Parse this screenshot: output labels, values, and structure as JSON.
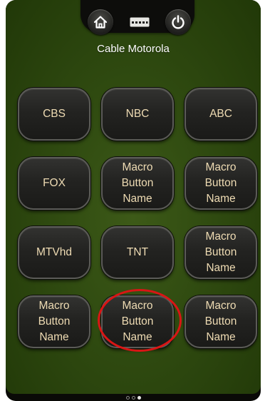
{
  "header": {
    "home_icon": "home-icon",
    "keyboard_icon": "keyboard-icon",
    "power_icon": "power-icon",
    "device_title": "Cable Motorola"
  },
  "buttons": [
    {
      "label": "CBS"
    },
    {
      "label": "NBC"
    },
    {
      "label": "ABC"
    },
    {
      "label": "FOX"
    },
    {
      "label": "Macro\nButton\nName"
    },
    {
      "label": "Macro\nButton\nName"
    },
    {
      "label": "MTVhd"
    },
    {
      "label": "TNT"
    },
    {
      "label": "Macro\nButton\nName"
    },
    {
      "label": "Macro\nButton\nName"
    },
    {
      "label": "Macro\nButton\nName"
    },
    {
      "label": "Macro\nButton\nName"
    }
  ],
  "pagination": {
    "total_pages": 3,
    "current_page": 3
  },
  "colors": {
    "background": "#2f4a10",
    "button_text": "#eedbb3",
    "highlight": "#d91515"
  }
}
